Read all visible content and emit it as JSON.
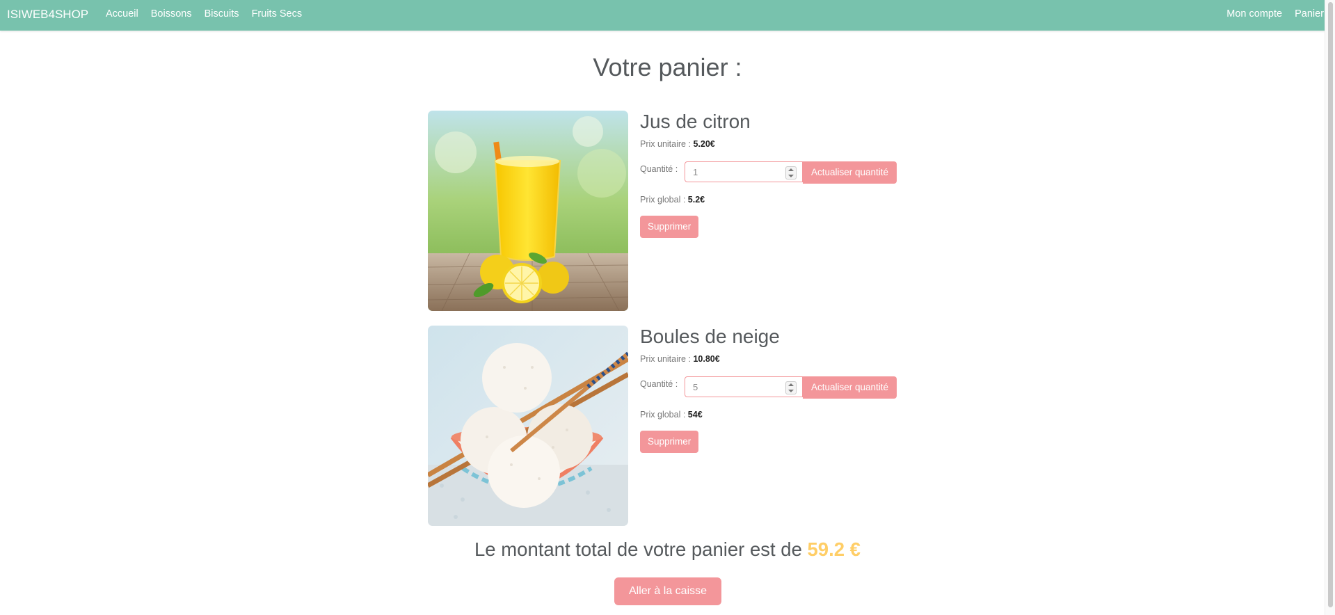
{
  "nav": {
    "brand": "ISIWEB4SHOP",
    "left_links": [
      "Accueil",
      "Boissons",
      "Biscuits",
      "Fruits Secs"
    ],
    "right_links": [
      "Mon compte",
      "Panier"
    ]
  },
  "page_title": "Votre panier :",
  "labels": {
    "unit_price": "Prix unitaire :",
    "quantity": "Quantité :",
    "global_price": "Prix global :",
    "update_button": "Actualiser quantité",
    "delete_button": "Supprimer"
  },
  "cart_items": [
    {
      "name": "Jus de citron",
      "unit_price": "5.20€",
      "quantity": "1",
      "global_price": "5.2€"
    },
    {
      "name": "Boules de neige",
      "unit_price": "10.80€",
      "quantity": "5",
      "global_price": "54€"
    }
  ],
  "total": {
    "text": "Le montant total de votre panier est de",
    "amount": "59.2 €"
  },
  "checkout_button": "Aller à la caisse",
  "colors": {
    "navbar": "#78c2ad",
    "button": "#f3969a",
    "total_amount": "#ffce67",
    "heading": "#55595c"
  }
}
